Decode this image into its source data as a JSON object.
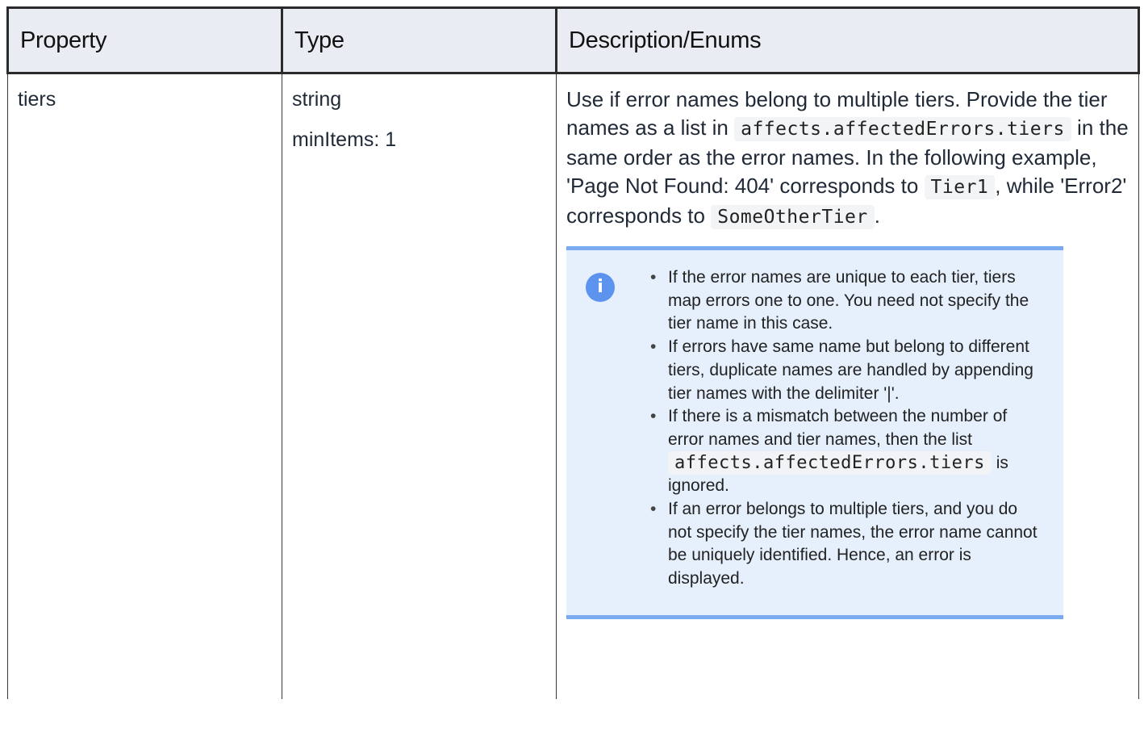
{
  "table": {
    "headers": [
      "Property",
      "Type",
      "Description/Enums"
    ],
    "row": {
      "property": "tiers",
      "type_lines": [
        "string",
        "minItems: 1"
      ],
      "description": {
        "part1": "Use if error names belong to multiple tiers. Provide the tier names as a list in ",
        "code1": "affects.affectedErrors.tiers",
        "part2": " in the same order as the error names. In the following example, 'Page Not Found: 404' corresponds to ",
        "code2": "Tier1",
        "part3": ", while 'Error2' corresponds to ",
        "code3": "SomeOtherTier",
        "part4": "."
      },
      "note": {
        "icon": "info-icon",
        "bullets": [
          "If the error names are unique to each tier, tiers map errors one to one. You need not specify the tier name in this case.",
          "If errors have same name but belong to different tiers, duplicate names are handled by appending tier names with the delimiter '|'.",
          {
            "before": "If there is a mismatch between the number of error names and tier names, then the list ",
            "code": "affects.affectedErrors.tiers",
            "after": " is ignored."
          },
          "If an error belongs to multiple tiers, and you do not specify the tier names, the error name cannot be uniquely identified. Hence, an error is displayed."
        ]
      }
    }
  },
  "colors": {
    "header_bg": "#e9ecf2",
    "note_bg": "#e6f0fd",
    "note_border": "#7aaaf0",
    "info_icon": "#5b93ee"
  }
}
